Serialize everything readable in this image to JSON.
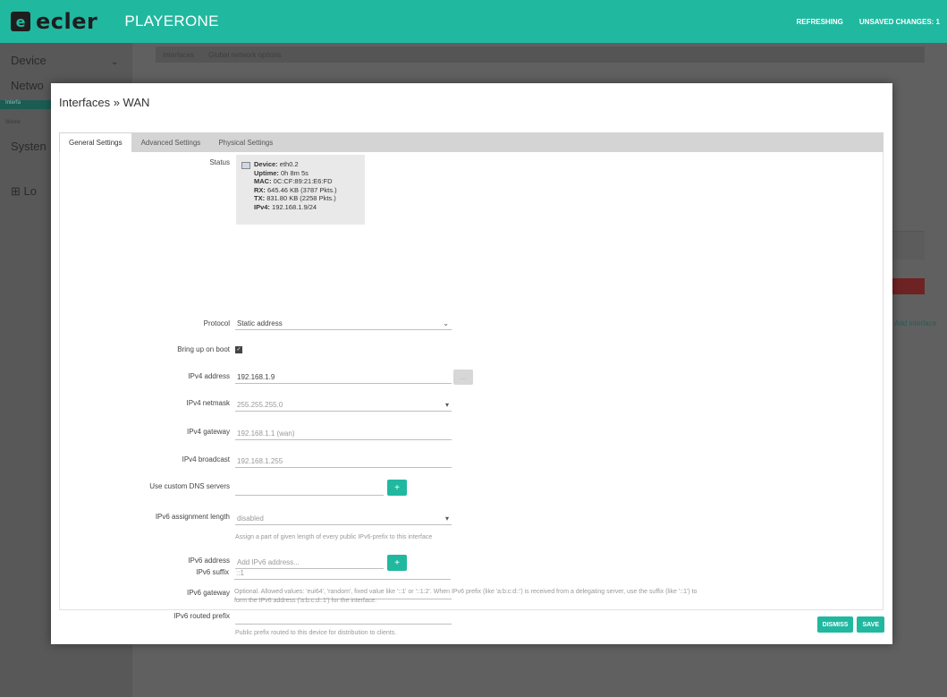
{
  "header": {
    "brand": "ecler",
    "brand_mark": "e",
    "product": "PLAYERONE",
    "refreshing": "REFRESHING",
    "unsaved": "UNSAVED CHANGES: 1"
  },
  "sidebar": {
    "device": "Device",
    "network": "Netwo",
    "system": "Systen",
    "logout": "Lo",
    "sub1": "Interfa",
    "sub2": "Wirele"
  },
  "background": {
    "tab1": "Interfaces",
    "tab2": "Global network options"
  },
  "modal": {
    "title": "Interfaces » WAN",
    "tabs": [
      "General Settings",
      "Advanced Settings",
      "Physical Settings"
    ],
    "status": {
      "label": "Status",
      "device_key": "Device:",
      "device_val": "eth0.2",
      "uptime_key": "Uptime:",
      "uptime_val": "0h 8m 5s",
      "mac_key": "MAC:",
      "mac_val": "0C:CF:89:21:E6:FD",
      "rx_key": "RX:",
      "rx_val": "645.46 KB (3787 Pkts.)",
      "tx_key": "TX:",
      "tx_val": "831.80 KB (2258 Pkts.)",
      "ipv4_key": "IPv4:",
      "ipv4_val": "192.168.1.9/24"
    },
    "fields": {
      "protocol_label": "Protocol",
      "protocol_value": "Static address",
      "boot_label": "Bring up on boot",
      "ipv4_address_label": "IPv4 address",
      "ipv4_address_value": "192.168.1.9",
      "ipv4_netmask_label": "IPv4 netmask",
      "ipv4_netmask_value": "255.255.255.0",
      "ipv4_gateway_label": "IPv4 gateway",
      "ipv4_gateway_value": "192.168.1.1 (wan)",
      "ipv4_broadcast_label": "IPv4 broadcast",
      "ipv4_broadcast_value": "192.168.1.255",
      "dns_label": "Use custom DNS servers",
      "ipv6_assign_label": "IPv6 assignment length",
      "ipv6_assign_value": "disabled",
      "ipv6_assign_hint": "Assign a part of given length of every public IPv6-prefix to this interface",
      "ipv6_address_label": "IPv6 address",
      "ipv6_address_placeholder": "Add IPv6 address...",
      "ipv6_gateway_label": "IPv6 gateway",
      "ipv6_prefix_label": "IPv6 routed prefix",
      "ipv6_prefix_hint": "Public prefix routed to this device for distribution to clients.",
      "ipv6_suffix_label": "IPv6 suffix",
      "ipv6_suffix_value": "::1",
      "ipv6_suffix_hint1": "Optional. Allowed values: 'eui64', 'random', fixed value like '::1' or '::1:2'. When IPv6 prefix (like 'a:b:c:d::') is received from a delegating server, use the suffix (like '::1') to",
      "ipv6_suffix_hint2": "form the IPv6 address ('a:b:c:d::1') for the interface."
    },
    "buttons": {
      "add": "+",
      "ellipsis": "...",
      "dismiss": "DISMISS",
      "save": "SAVE"
    }
  },
  "colors": {
    "accent": "#21b8a0",
    "danger": "#6e2323"
  }
}
